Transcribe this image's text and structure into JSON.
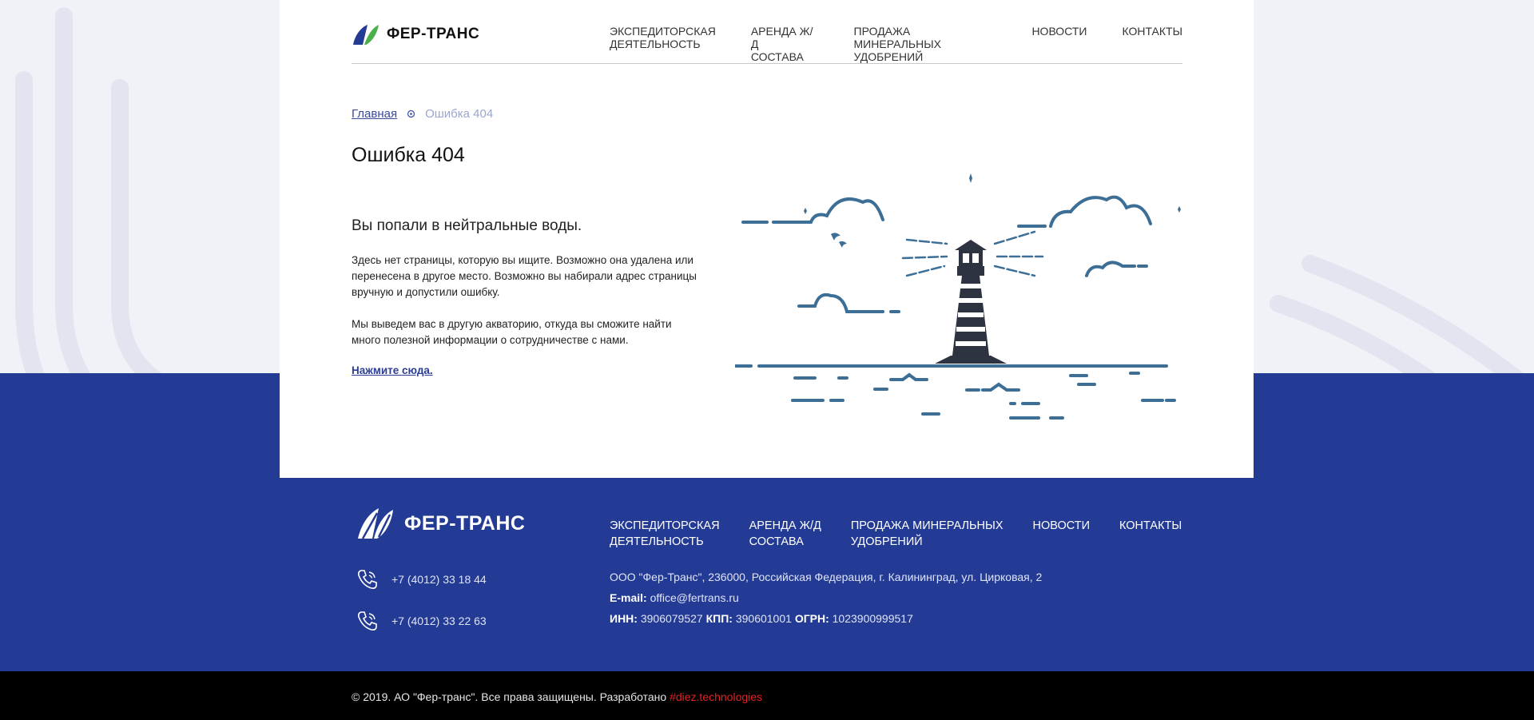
{
  "brand": {
    "name": "ФЕР-ТРАНС"
  },
  "nav": [
    {
      "label": "ЭКСПЕДИТОРСКАЯ\nДЕЯТЕЛЬНОСТЬ"
    },
    {
      "label": "АРЕНДА Ж/Д\nСОСТАВА"
    },
    {
      "label": "ПРОДАЖА МИНЕРАЛЬНЫХ\nУДОБРЕНИЙ"
    },
    {
      "label": "НОВОСТИ"
    },
    {
      "label": "КОНТАКТЫ"
    }
  ],
  "breadcrumb": {
    "home": "Главная",
    "current": "Ошибка 404"
  },
  "page": {
    "title": "Ошибка 404",
    "subtitle": "Вы попали в нейтральные воды.",
    "para1": "Здесь нет страницы, которую вы ищите. Возможно она удалена или перенесена в другое место. Возможно вы набирали адрес страницы вручную и допустили ошибку.",
    "para2": "Мы выведем вас в другую акваторию, откуда вы сможите найти много полезной информации о сотрудничестве с нами.",
    "cta": "Нажмите сюда."
  },
  "footer": {
    "brand": "ФЕР-ТРАНС",
    "nav": [
      {
        "label": "ЭКСПЕДИТОРСКАЯ\nДЕЯТЕЛЬНОСТЬ"
      },
      {
        "label": "АРЕНДА Ж/Д\nСОСТАВА"
      },
      {
        "label": "ПРОДАЖА МИНЕРАЛЬНЫХ\nУДОБРЕНИЙ"
      },
      {
        "label": "НОВОСТИ"
      },
      {
        "label": "КОНТАКТЫ"
      }
    ],
    "phones": [
      "+7 (4012) 33 18 44",
      "+7 (4012) 33 22 63"
    ],
    "address": "ООО \"Фер-Транс\", 236000, Российская Федерация, г. Калининград, ул. Цирковая, 2",
    "email_label": "E-mail:",
    "email": "office@fertrans.ru",
    "inn_label": "ИНН:",
    "inn": "3906079527",
    "kpp_label": "КПП:",
    "kpp": "390601001",
    "ogrn_label": "ОГРН:",
    "ogrn": "1023900999517",
    "copyright": "© 2019. АО \"Фер-транс\". Все права защищены. Разработано",
    "developer": "#diez.technologies"
  },
  "colors": {
    "primary": "#243b96",
    "accent": "#e32121",
    "illustration": "#3c6e96",
    "dark": "#2d3340"
  }
}
